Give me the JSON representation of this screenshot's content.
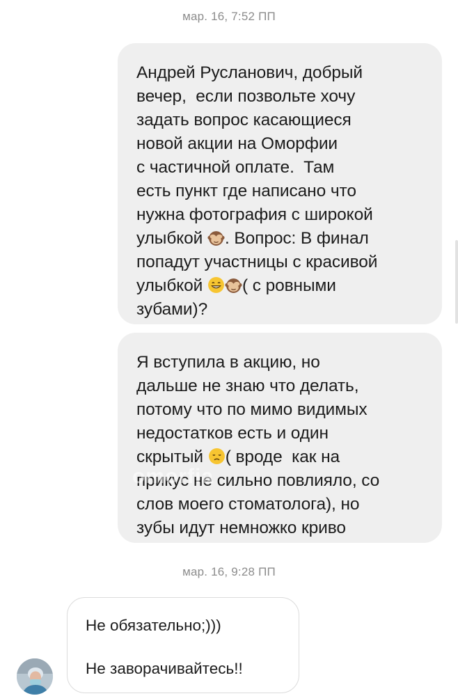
{
  "thread": {
    "timestamp_1": "мар. 16, 7:52 ПП",
    "timestamp_2": "мар. 16, 9:28 ПП",
    "msg1": {
      "l1": "Андрей Русланович, добрый",
      "l2": "вечер,  если позвольте хочу",
      "l3": "задать вопрос касающиеся",
      "l4": "новой акции на Оморфии",
      "l5": "с частичной оплате.  Там",
      "l6": "есть пункт где написано что",
      "l7": "нужна фотография с широкой",
      "l8a": "улыбкой ",
      "l8b": ". Вопрос: В финал",
      "l9": "попадут участницы с красивой",
      "l10a": "улыбкой ",
      "l10b": "( с ровными",
      "l11": "зубами)?"
    },
    "msg2": {
      "l1": "Я вступила в акцию, но",
      "l2": "дальше не знаю что делать,",
      "l3": "потому что по мимо видимых",
      "l4": "недостатков есть и один",
      "l5a": "скрытый ",
      "l5b": "( вроде  как на",
      "l6": "прикус не сильно повлияло, со",
      "l7": "слов моего стоматолога), но",
      "l8": "зубы идут немножко криво"
    },
    "reply": {
      "line1": "Не обязательно;)))",
      "line2": "Не заворачивайтесь!!"
    },
    "watermark": "omorfia"
  },
  "icons": {
    "see_no_evil": "see-no-evil-monkey-emoji",
    "grin": "grinning-face-emoji",
    "disappointed": "disappointed-face-emoji"
  }
}
